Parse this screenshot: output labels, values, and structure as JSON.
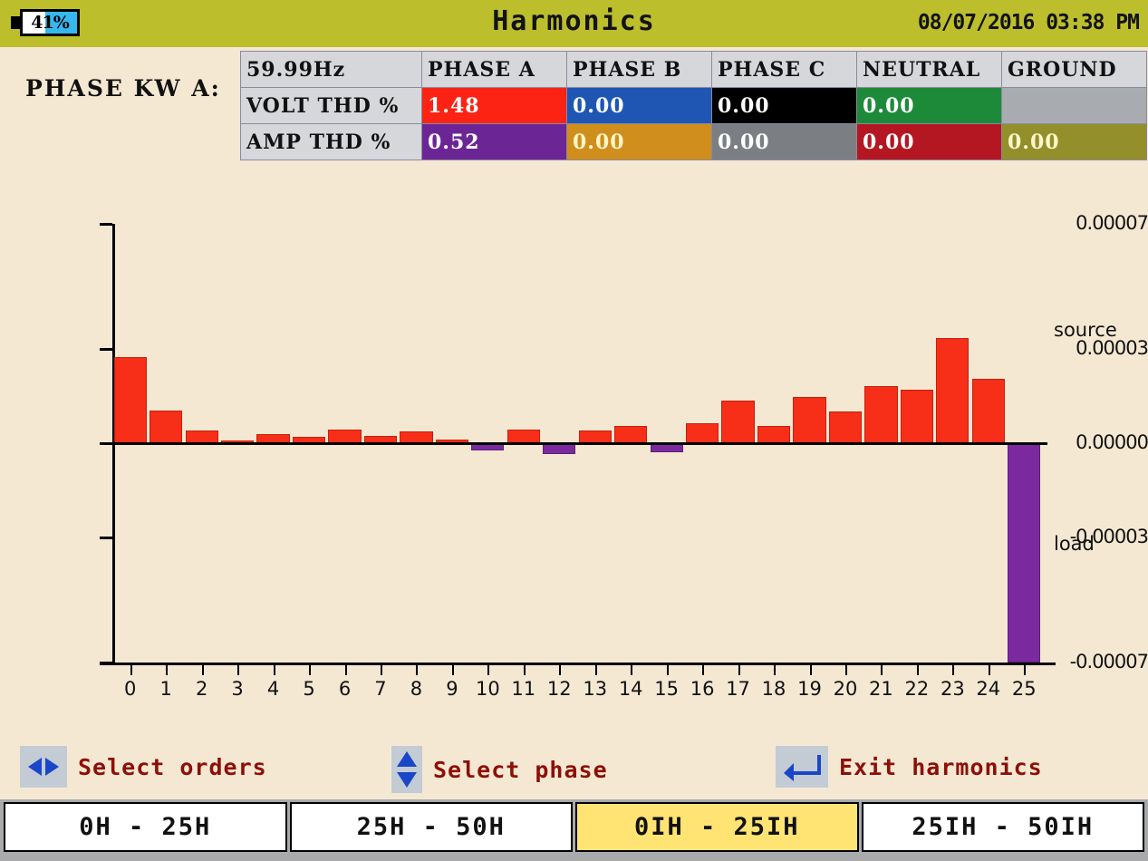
{
  "titlebar": {
    "battery_percent": "41%",
    "battery_level": 41,
    "title": "Harmonics",
    "datetime": "08/07/2016 03:38 PM",
    "bg_color": "#bcbe2c"
  },
  "phase_label": "PHASE KW A:",
  "thd_table": {
    "columns": [
      "59.99Hz",
      "PHASE A",
      "PHASE B",
      "PHASE C",
      "NEUTRAL",
      "GROUND"
    ],
    "rows": [
      {
        "label": "VOLT THD %",
        "cells": [
          {
            "value": "1.48",
            "bg": "#fc2314",
            "fg": "#ffffff"
          },
          {
            "value": "0.00",
            "bg": "#1f56b4",
            "fg": "#ffffff"
          },
          {
            "value": "0.00",
            "bg": "#000000",
            "fg": "#ffffff"
          },
          {
            "value": "0.00",
            "bg": "#1d8a3a",
            "fg": "#ffffff"
          },
          {
            "value": "",
            "bg": "#a8acb0",
            "fg": "#ffffff"
          }
        ]
      },
      {
        "label": "AMP THD %",
        "cells": [
          {
            "value": "0.52",
            "bg": "#6c2595",
            "fg": "#ffffff"
          },
          {
            "value": "0.00",
            "bg": "#d08e1c",
            "fg": "#fdf6c8"
          },
          {
            "value": "0.00",
            "bg": "#7b7f84",
            "fg": "#ffffff"
          },
          {
            "value": "0.00",
            "bg": "#b41622",
            "fg": "#ffffff"
          },
          {
            "value": "0.00",
            "bg": "#938f2b",
            "fg": "#fdf6c8"
          }
        ]
      }
    ]
  },
  "chart_data": {
    "type": "bar",
    "title": "",
    "xlabel": "",
    "ylabel": "",
    "ylim": [
      -7e-05,
      7e-05
    ],
    "ytick_labels": [
      "0.00007",
      "0.00003",
      "0.00000",
      "-0.00003",
      "-0.00007"
    ],
    "ytick_values": [
      7e-05,
      3e-05,
      0.0,
      -3e-05,
      -7e-05
    ],
    "grid": false,
    "legend": "none",
    "annotations": [
      {
        "text": "source",
        "position": "right-upper"
      },
      {
        "text": "load",
        "position": "right-lower"
      }
    ],
    "colors": {
      "positive": "#f72e18",
      "negative": "#7a2a9e"
    },
    "categories": [
      "0",
      "1",
      "2",
      "3",
      "4",
      "5",
      "6",
      "7",
      "8",
      "9",
      "10",
      "11",
      "12",
      "13",
      "14",
      "15",
      "16",
      "17",
      "18",
      "19",
      "20",
      "21",
      "22",
      "23",
      "24",
      "25"
    ],
    "values": [
      2.75e-05,
      1.05e-05,
      4e-06,
      5e-07,
      3e-06,
      2e-06,
      4.2e-06,
      2.2e-06,
      3.8e-06,
      1.2e-06,
      -2.2e-06,
      4.2e-06,
      -3.5e-06,
      4e-06,
      5.5e-06,
      -3e-06,
      6.5e-06,
      1.35e-05,
      5.5e-06,
      1.48e-05,
      1e-05,
      1.82e-05,
      1.7e-05,
      3.35e-05,
      2.05e-05,
      -7e-05
    ]
  },
  "actions": [
    {
      "label": "Select orders",
      "icon": "left-right-arrows-icon"
    },
    {
      "label": "Select phase",
      "icon": "up-down-arrows-icon"
    },
    {
      "label": "Exit harmonics",
      "icon": "enter-arrow-icon"
    }
  ],
  "tabs": [
    {
      "label": "0H - 25H",
      "active": false
    },
    {
      "label": "25H - 50H",
      "active": false
    },
    {
      "label": "0IH - 25IH",
      "active": true
    },
    {
      "label": "25IH - 50IH",
      "active": false
    }
  ]
}
